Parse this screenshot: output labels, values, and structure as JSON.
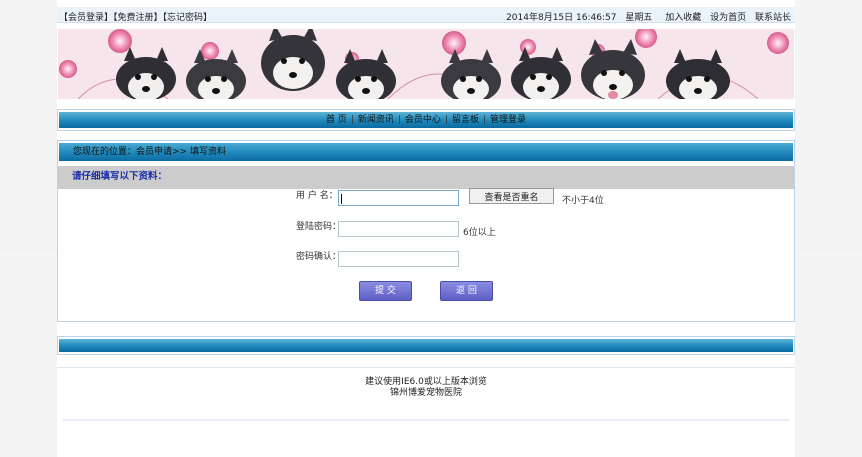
{
  "topbar": {
    "links": [
      "【会员登录】",
      "【免费注册】",
      "【忘记密码】"
    ],
    "datetime": "2014年8月15日 16:46:57",
    "weekday": "星期五",
    "actions": [
      "加入收藏",
      "设为首页",
      "联系站长"
    ]
  },
  "nav": {
    "items": [
      "首 页",
      "新闻资讯",
      "会员中心",
      "留言板",
      "管理登录"
    ],
    "separator": "|"
  },
  "breadcrumb": "您现在的位置：会员申请>> 填写资料",
  "form": {
    "heading": "请仔细填写以下资料：",
    "username_label": "用 户 名：",
    "username_value": "",
    "check_button": "查看是否重名",
    "username_hint": "不小于4位",
    "password_label": "登陆密码：",
    "password_hint": "6位以上",
    "confirm_label": "密码确认：",
    "submit_label": "提 交",
    "back_label": "返 回"
  },
  "footer": {
    "line1": "建议使用IE6.0或以上版本浏览",
    "line2": "锦州博爱宠物医院"
  },
  "colors": {
    "nav_bar": "#1e88bb",
    "heading_text": "#1a2fa8",
    "button_purple": "#6a6cd0",
    "gray_bar": "#cccccc"
  }
}
